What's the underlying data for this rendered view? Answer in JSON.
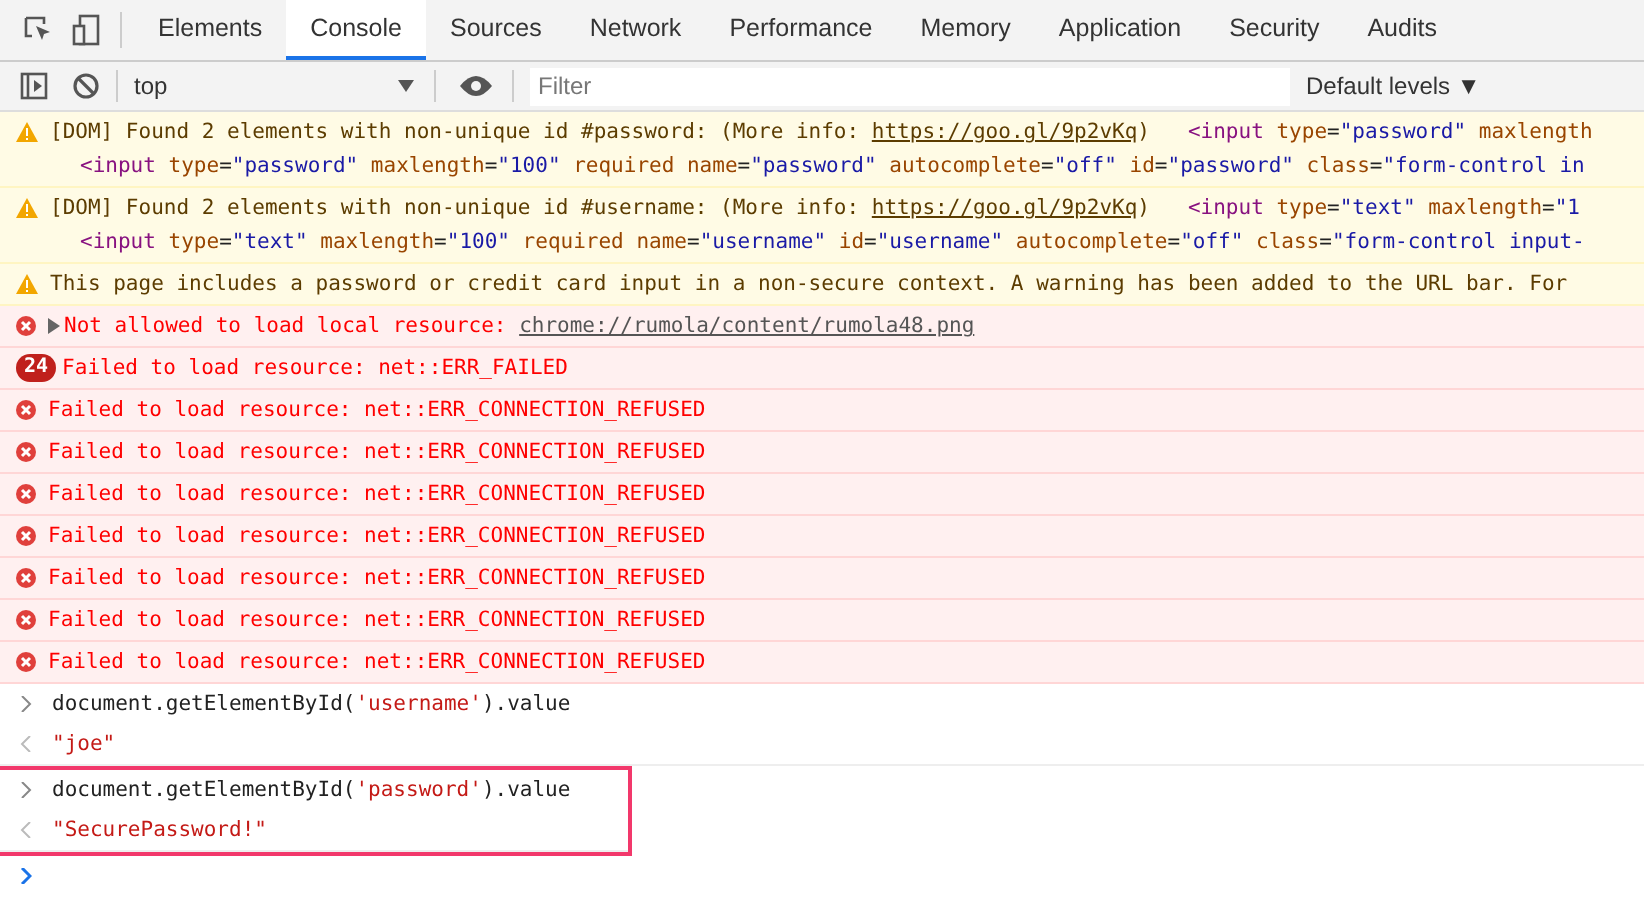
{
  "tabs": [
    {
      "label": "Elements",
      "selected": false
    },
    {
      "label": "Console",
      "selected": true
    },
    {
      "label": "Sources",
      "selected": false
    },
    {
      "label": "Network",
      "selected": false
    },
    {
      "label": "Performance",
      "selected": false
    },
    {
      "label": "Memory",
      "selected": false
    },
    {
      "label": "Application",
      "selected": false
    },
    {
      "label": "Security",
      "selected": false
    },
    {
      "label": "Audits",
      "selected": false
    }
  ],
  "toolbar": {
    "context": "top",
    "filter_placeholder": "Filter",
    "levels": "Default levels ▼"
  },
  "messages": [
    {
      "kind": "warning",
      "text": "[DOM] Found 2 elements with non-unique id #password: (More info: ",
      "link": "https://goo.gl/9p2vKq",
      "after": ")   ",
      "code": [
        {
          "kind": "tag",
          "text": "<input "
        },
        {
          "kind": "attr",
          "text": "type"
        },
        {
          "kind": "plain",
          "text": "="
        },
        {
          "kind": "value",
          "text": "\"password\""
        },
        {
          "kind": "attr",
          "text": " maxlength"
        }
      ],
      "code2": [
        {
          "kind": "tag",
          "text": "<input "
        },
        {
          "kind": "attr",
          "text": "type"
        },
        {
          "kind": "plain",
          "text": "="
        },
        {
          "kind": "value",
          "text": "\"password\""
        },
        {
          "kind": "attr",
          "text": " maxlength"
        },
        {
          "kind": "plain",
          "text": "="
        },
        {
          "kind": "value",
          "text": "\"100\""
        },
        {
          "kind": "attr",
          "text": " required name"
        },
        {
          "kind": "plain",
          "text": "="
        },
        {
          "kind": "value",
          "text": "\"password\""
        },
        {
          "kind": "attr",
          "text": " autocomplete"
        },
        {
          "kind": "plain",
          "text": "="
        },
        {
          "kind": "value",
          "text": "\"off\""
        },
        {
          "kind": "attr",
          "text": " id"
        },
        {
          "kind": "plain",
          "text": "="
        },
        {
          "kind": "value",
          "text": "\"password\""
        },
        {
          "kind": "attr",
          "text": " class"
        },
        {
          "kind": "plain",
          "text": "="
        },
        {
          "kind": "value",
          "text": "\"form-control in"
        }
      ]
    },
    {
      "kind": "warning",
      "text": "[DOM] Found 2 elements with non-unique id #username: (More info: ",
      "link": "https://goo.gl/9p2vKq",
      "after": ")   ",
      "code": [
        {
          "kind": "tag",
          "text": "<input "
        },
        {
          "kind": "attr",
          "text": "type"
        },
        {
          "kind": "plain",
          "text": "="
        },
        {
          "kind": "value",
          "text": "\"text\""
        },
        {
          "kind": "attr",
          "text": " maxlength"
        },
        {
          "kind": "plain",
          "text": "="
        },
        {
          "kind": "value",
          "text": "\"1"
        }
      ],
      "code2": [
        {
          "kind": "tag",
          "text": "<input "
        },
        {
          "kind": "attr",
          "text": "type"
        },
        {
          "kind": "plain",
          "text": "="
        },
        {
          "kind": "value",
          "text": "\"text\""
        },
        {
          "kind": "attr",
          "text": " maxlength"
        },
        {
          "kind": "plain",
          "text": "="
        },
        {
          "kind": "value",
          "text": "\"100\""
        },
        {
          "kind": "attr",
          "text": " required name"
        },
        {
          "kind": "plain",
          "text": "="
        },
        {
          "kind": "value",
          "text": "\"username\""
        },
        {
          "kind": "attr",
          "text": " id"
        },
        {
          "kind": "plain",
          "text": "="
        },
        {
          "kind": "value",
          "text": "\"username\""
        },
        {
          "kind": "attr",
          "text": " autocomplete"
        },
        {
          "kind": "plain",
          "text": "="
        },
        {
          "kind": "value",
          "text": "\"off\""
        },
        {
          "kind": "attr",
          "text": " class"
        },
        {
          "kind": "plain",
          "text": "="
        },
        {
          "kind": "value",
          "text": "\"form-control input-"
        }
      ]
    },
    {
      "kind": "warning",
      "text": "This page includes a password or credit card input in a non-secure context. A warning has been added to the URL bar. For"
    },
    {
      "kind": "error",
      "expandable": true,
      "text": "Not allowed to load local resource: ",
      "link": "chrome://rumola/content/rumola48.png"
    },
    {
      "kind": "error",
      "count": "24",
      "text": "Failed to load resource: net::ERR_FAILED"
    },
    {
      "kind": "error",
      "text": "Failed to load resource: net::ERR_CONNECTION_REFUSED"
    },
    {
      "kind": "error",
      "text": "Failed to load resource: net::ERR_CONNECTION_REFUSED"
    },
    {
      "kind": "error",
      "text": "Failed to load resource: net::ERR_CONNECTION_REFUSED"
    },
    {
      "kind": "error",
      "text": "Failed to load resource: net::ERR_CONNECTION_REFUSED"
    },
    {
      "kind": "error",
      "text": "Failed to load resource: net::ERR_CONNECTION_REFUSED"
    },
    {
      "kind": "error",
      "text": "Failed to load resource: net::ERR_CONNECTION_REFUSED"
    },
    {
      "kind": "error",
      "text": "Failed to load resource: net::ERR_CONNECTION_REFUSED"
    },
    {
      "kind": "input",
      "code": [
        {
          "kind": "plain",
          "text": "document.getElementById("
        },
        {
          "kind": "string",
          "text": "'username'"
        },
        {
          "kind": "plain",
          "text": ").value"
        }
      ]
    },
    {
      "kind": "output",
      "code": [
        {
          "kind": "string",
          "text": "\"joe\""
        }
      ]
    },
    {
      "kind": "input",
      "highlighted": true,
      "code": [
        {
          "kind": "plain",
          "text": "document.getElementById("
        },
        {
          "kind": "string",
          "text": "'password'"
        },
        {
          "kind": "plain",
          "text": ").value"
        }
      ]
    },
    {
      "kind": "output",
      "highlighted": true,
      "code": [
        {
          "kind": "string",
          "text": "\"SecurePassword!\""
        }
      ]
    }
  ]
}
